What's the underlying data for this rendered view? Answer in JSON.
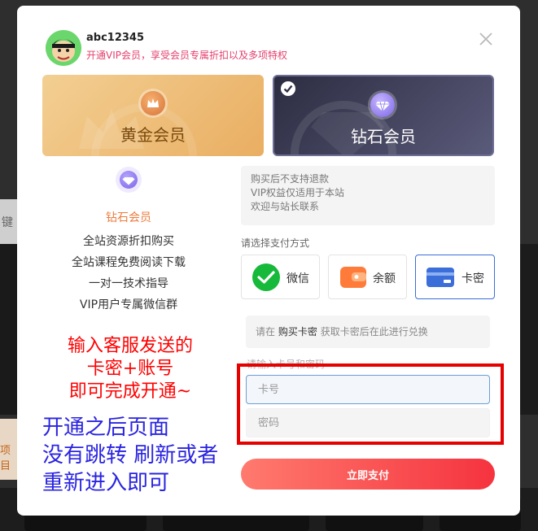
{
  "background": {
    "left_strip_text_top": "键",
    "left_strip_text_bottom": "项目"
  },
  "user": {
    "name": "abc12345",
    "promo": "开通VIP会员，享受会员专属折扣以及多项特权"
  },
  "tiers": {
    "gold_label": "黄金会员",
    "diamond_label": "钻石会员",
    "selected": "diamond"
  },
  "side": {
    "title": "钻石会员",
    "benefits": [
      "全站资源折扣购买",
      "全站课程免费阅读下载",
      "一对一技术指导",
      "VIP用户专属微信群"
    ]
  },
  "notice": {
    "lines": [
      "购买后不支持退款",
      "VIP权益仅适用于本站",
      "欢迎与站长联系"
    ]
  },
  "payment": {
    "title": "请选择支付方式",
    "methods": {
      "wechat": "微信",
      "balance": "余额",
      "card": "卡密"
    },
    "selected": "card"
  },
  "hint": {
    "prefix": "请在",
    "link": "购买卡密",
    "suffix": "获取卡密后在此进行兑换"
  },
  "form": {
    "caption": "请输入卡号和密码",
    "card_placeholder": "卡号",
    "password_placeholder": "密码",
    "submit": "立即支付"
  },
  "annotations": {
    "red_lines": [
      "输入客服发送的",
      "卡密+账号",
      "即可完成开通~"
    ],
    "blue_lines": [
      "开通之后页面",
      "没有跳转 刷新或者",
      "重新进入即可"
    ]
  },
  "colors": {
    "promo": "#e4406e",
    "accent_orange": "#ec7c3f",
    "pay_button": "#f5333f",
    "selected_border": "#3b6ed8",
    "annotation_red": "#ff0000",
    "annotation_blue": "#2a24e0"
  }
}
